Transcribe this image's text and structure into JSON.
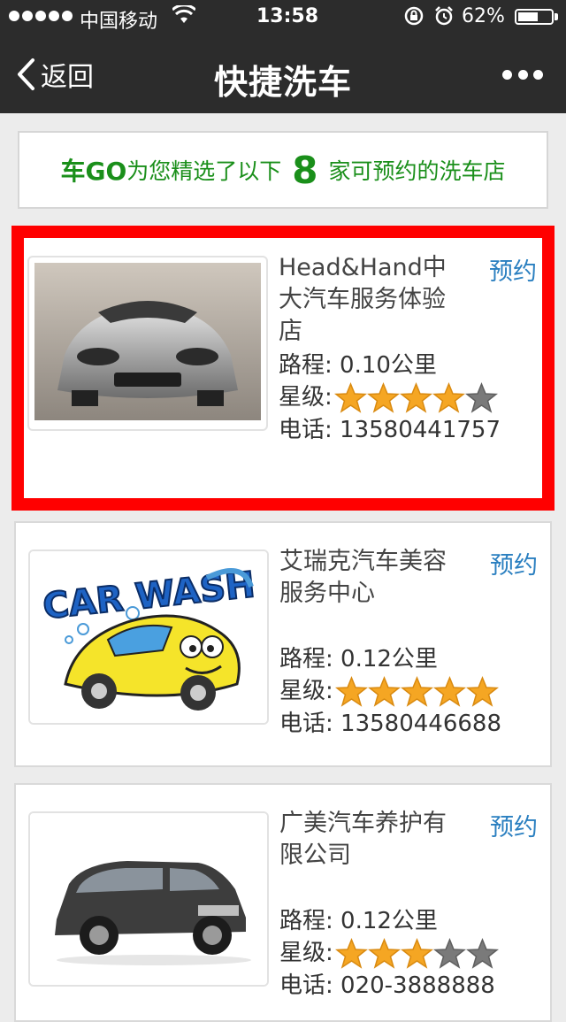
{
  "status_bar": {
    "carrier": "中国移动",
    "time": "13:58",
    "battery_text": "62%",
    "battery_level": 0.62
  },
  "nav": {
    "back_label": "返回",
    "title": "快捷洗车"
  },
  "banner": {
    "brand": "车GO",
    "text_before": "为您精选了以下",
    "count": "8",
    "text_after": "家可预约的洗车店"
  },
  "shops": [
    {
      "name": "Head&Hand中大汽车服务体验店",
      "reserve_label": "预约",
      "distance": "路程: 0.10公里",
      "rating_label": "星级:",
      "rating": 4,
      "max_rating": 5,
      "phone": "电话: 13580441757",
      "image": "silver-sports-car"
    },
    {
      "name": "艾瑞克汽车美容服务中心",
      "reserve_label": "预约",
      "distance": "路程: 0.12公里",
      "rating_label": "星级:",
      "rating": 5,
      "max_rating": 5,
      "phone": "电话: 13580446688",
      "image": "car-wash-cartoon",
      "image_text": "CAR WASH"
    },
    {
      "name": "广美汽车养护有限公司",
      "reserve_label": "预约",
      "distance": "路程: 0.12公里",
      "rating_label": "星级:",
      "rating": 3,
      "max_rating": 5,
      "phone": "电话: 020-3888888",
      "image": "dark-suv"
    }
  ],
  "colors": {
    "bar_bg": "#2c2c2c",
    "banner_green": "#1a8f1a",
    "reserve_blue": "#2a7fc0",
    "highlight_red": "#ff0000",
    "star_gold": "#f5a623",
    "star_gray": "#7a7a7a"
  }
}
